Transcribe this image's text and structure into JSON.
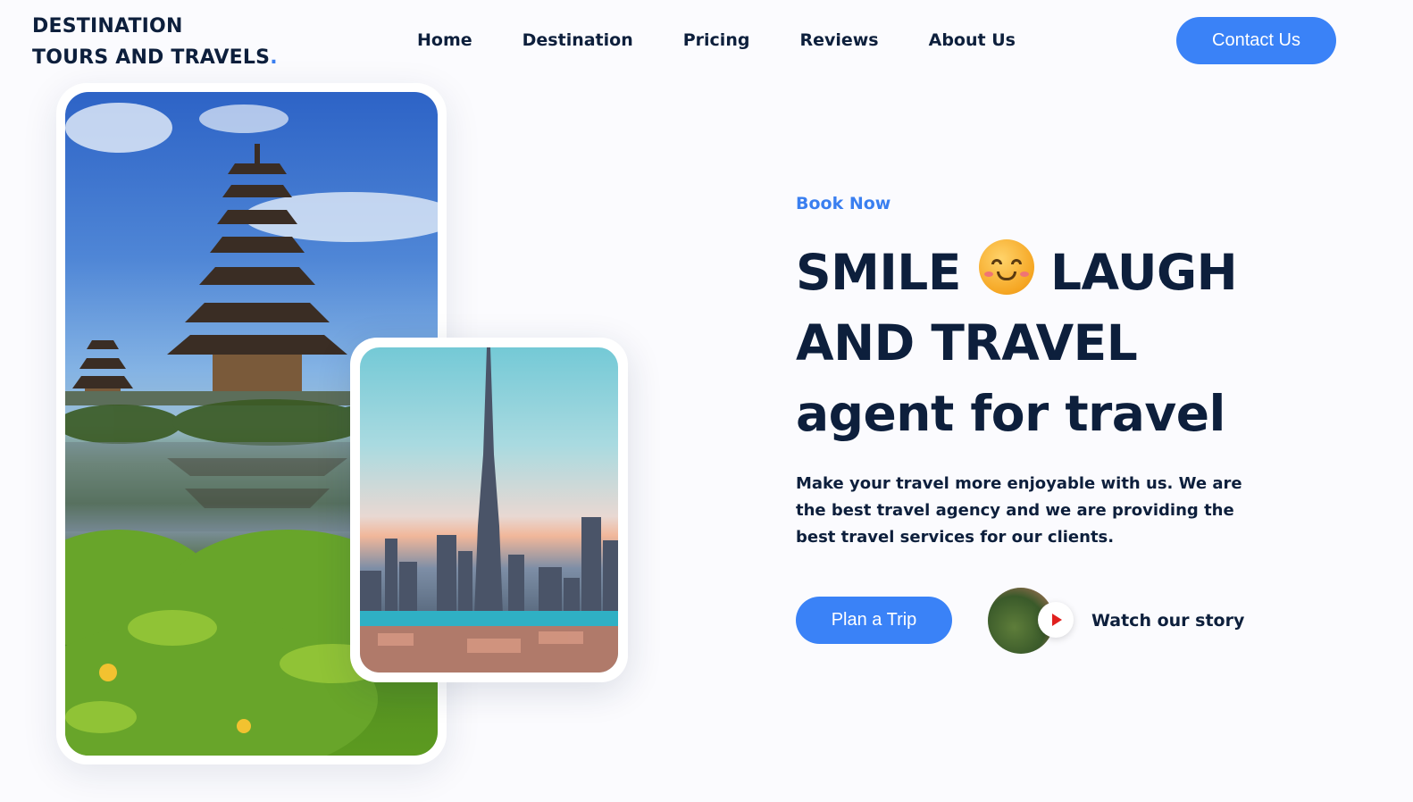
{
  "header": {
    "logo_line1": "DESTINATION",
    "logo_line2": "TOURS AND TRAVELS",
    "logo_dot": ".",
    "nav": [
      "Home",
      "Destination",
      "Pricing",
      "Reviews",
      "About Us"
    ],
    "contact_label": "Contact Us"
  },
  "hero": {
    "eyebrow": "Book Now",
    "headline_line1_a": "SMILE",
    "headline_line1_b": "LAUGH",
    "headline_line2": "AND TRAVEL",
    "headline_line3": "agent for travel",
    "emoji": "smiling-face-icon",
    "lead": "Make your travel more enjoyable with us. We are the best travel agency and we are providing the best travel services for our clients.",
    "plan_label": "Plan a Trip",
    "story_label": "Watch our story"
  },
  "colors": {
    "accent": "#3a82f7",
    "heading": "#0d1f3c",
    "background": "#fbfbfe"
  }
}
